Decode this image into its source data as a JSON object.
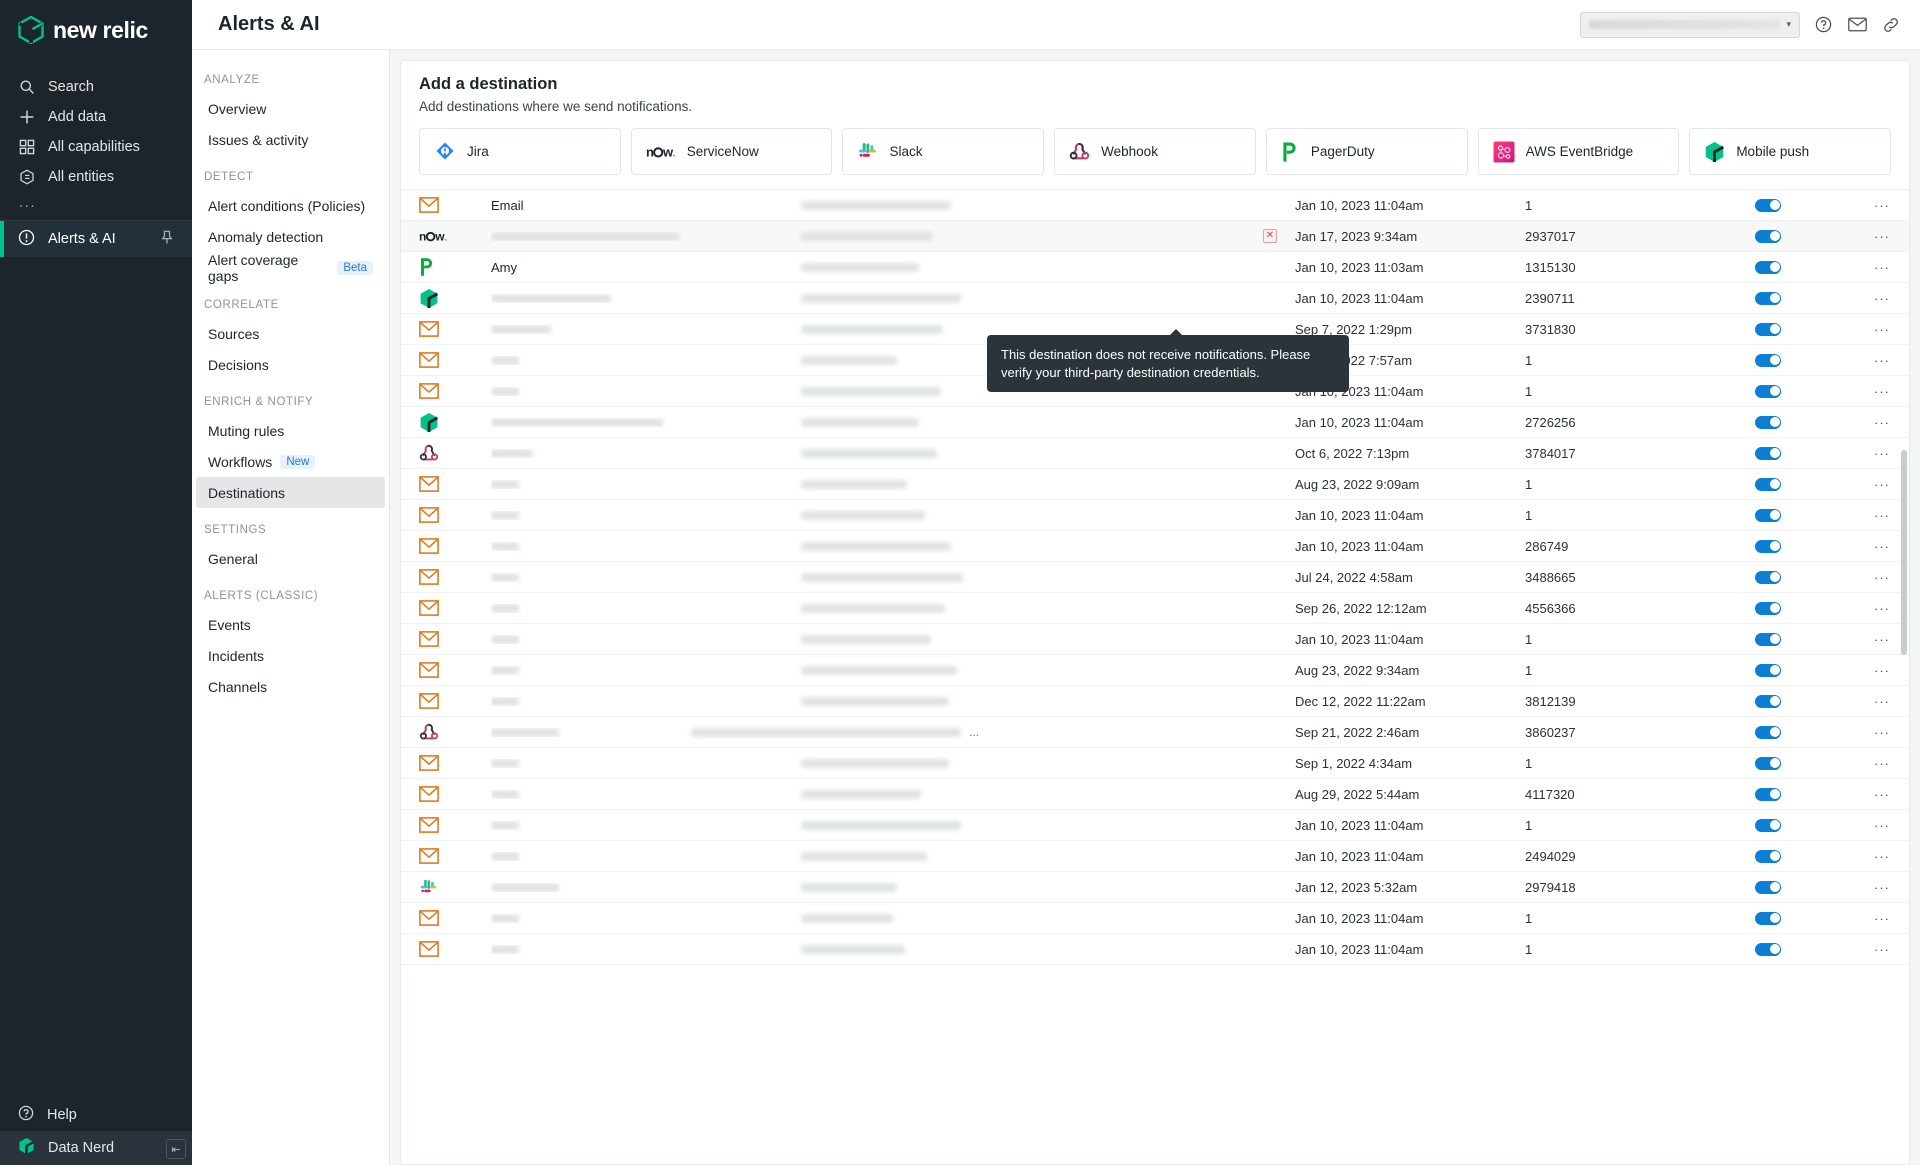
{
  "brand": {
    "name": "new relic",
    "dot": "."
  },
  "primary_nav": {
    "items": [
      {
        "label": "Search",
        "icon": "search-icon"
      },
      {
        "label": "Add data",
        "icon": "plus-icon"
      },
      {
        "label": "All capabilities",
        "icon": "grid-icon"
      },
      {
        "label": "All entities",
        "icon": "hexagon-list-icon"
      }
    ],
    "more": "...",
    "active_item": {
      "label": "Alerts & AI",
      "icon": "alert-circle-icon",
      "pin": "pin-icon"
    },
    "bottom": [
      {
        "label": "Help",
        "icon": "help-circle-icon"
      },
      {
        "label": "Data Nerd",
        "icon": "user-avatar-icon"
      }
    ],
    "collapse": "⇤"
  },
  "header": {
    "title": "Alerts & AI",
    "account_selector_placeholder": "",
    "icons": [
      "help-icon",
      "mail-icon",
      "link-icon"
    ]
  },
  "secondary_nav": {
    "groups": [
      {
        "label": "ANALYZE",
        "items": [
          {
            "label": "Overview"
          },
          {
            "label": "Issues & activity"
          }
        ]
      },
      {
        "label": "DETECT",
        "items": [
          {
            "label": "Alert conditions (Policies)"
          },
          {
            "label": "Anomaly detection"
          },
          {
            "label": "Alert coverage gaps",
            "badge": "Beta"
          }
        ]
      },
      {
        "label": "CORRELATE",
        "items": [
          {
            "label": "Sources"
          },
          {
            "label": "Decisions"
          }
        ]
      },
      {
        "label": "ENRICH & NOTIFY",
        "items": [
          {
            "label": "Muting rules"
          },
          {
            "label": "Workflows",
            "badge": "New"
          },
          {
            "label": "Destinations",
            "active": true
          }
        ]
      },
      {
        "label": "SETTINGS",
        "items": [
          {
            "label": "General"
          }
        ]
      },
      {
        "label": "ALERTS (CLASSIC)",
        "items": [
          {
            "label": "Events"
          },
          {
            "label": "Incidents"
          },
          {
            "label": "Channels"
          }
        ]
      }
    ]
  },
  "main": {
    "title": "Add a destination",
    "subtitle": "Add destinations where we send notifications.",
    "destination_cards": [
      {
        "label": "Jira",
        "icon": "jira-icon"
      },
      {
        "label": "ServiceNow",
        "icon": "servicenow-icon"
      },
      {
        "label": "Slack",
        "icon": "slack-icon"
      },
      {
        "label": "Webhook",
        "icon": "webhook-icon"
      },
      {
        "label": "PagerDuty",
        "icon": "pagerduty-icon"
      },
      {
        "label": "AWS EventBridge",
        "icon": "aws-eventbridge-icon"
      },
      {
        "label": "Mobile push",
        "icon": "mobile-push-icon"
      }
    ],
    "table": {
      "rows": [
        {
          "icon": "email-icon",
          "name": "Email",
          "date": "Jan 10, 2023 11:04am",
          "count": "1",
          "enabled": true
        },
        {
          "icon": "servicenow-icon",
          "name": "",
          "date": "Jan 17, 2023 9:34am",
          "count": "2937017",
          "enabled": true,
          "error": true
        },
        {
          "icon": "pagerduty-icon",
          "name": "Amy",
          "date": "Jan 10, 2023 11:03am",
          "count": "1315130",
          "enabled": true
        },
        {
          "icon": "mobile-push-icon",
          "name": "",
          "date": "Jan 10, 2023 11:04am",
          "count": "2390711",
          "enabled": true
        },
        {
          "icon": "email-icon",
          "name": "",
          "date": "Sep 7, 2022 1:29pm",
          "count": "3731830",
          "enabled": true
        },
        {
          "icon": "email-icon",
          "name": "",
          "date": "Sep 1, 2022 7:57am",
          "count": "1",
          "enabled": true
        },
        {
          "icon": "email-icon",
          "name": "",
          "date": "Jan 10, 2023 11:04am",
          "count": "1",
          "enabled": true
        },
        {
          "icon": "mobile-push-icon",
          "name": "",
          "date": "Jan 10, 2023 11:04am",
          "count": "2726256",
          "enabled": true
        },
        {
          "icon": "webhook-icon",
          "name": "",
          "date": "Oct 6, 2022 7:13pm",
          "count": "3784017",
          "enabled": true
        },
        {
          "icon": "email-icon",
          "name": "",
          "date": "Aug 23, 2022 9:09am",
          "count": "1",
          "enabled": true
        },
        {
          "icon": "email-icon",
          "name": "",
          "date": "Jan 10, 2023 11:04am",
          "count": "1",
          "enabled": true
        },
        {
          "icon": "email-icon",
          "name": "",
          "date": "Jan 10, 2023 11:04am",
          "count": "286749",
          "enabled": true
        },
        {
          "icon": "email-icon",
          "name": "",
          "date": "Jul 24, 2022 4:58am",
          "count": "3488665",
          "enabled": true
        },
        {
          "icon": "email-icon",
          "name": "",
          "date": "Sep 26, 2022 12:12am",
          "count": "4556366",
          "enabled": true
        },
        {
          "icon": "email-icon",
          "name": "",
          "date": "Jan 10, 2023 11:04am",
          "count": "1",
          "enabled": true
        },
        {
          "icon": "email-icon",
          "name": "",
          "date": "Aug 23, 2022 9:34am",
          "count": "1",
          "enabled": true
        },
        {
          "icon": "email-icon",
          "name": "",
          "date": "Dec 12, 2022 11:22am",
          "count": "3812139",
          "enabled": true
        },
        {
          "icon": "webhook-icon",
          "name": "",
          "date": "Sep 21, 2022 2:46am",
          "count": "3860237",
          "enabled": true,
          "overflow": "..."
        },
        {
          "icon": "email-icon",
          "name": "",
          "date": "Sep 1, 2022 4:34am",
          "count": "1",
          "enabled": true
        },
        {
          "icon": "email-icon",
          "name": "",
          "date": "Aug 29, 2022 5:44am",
          "count": "4117320",
          "enabled": true
        },
        {
          "icon": "email-icon",
          "name": "",
          "date": "Jan 10, 2023 11:04am",
          "count": "1",
          "enabled": true
        },
        {
          "icon": "email-icon",
          "name": "",
          "date": "Jan 10, 2023 11:04am",
          "count": "2494029",
          "enabled": true
        },
        {
          "icon": "slack-icon",
          "name": "",
          "date": "Jan 12, 2023 5:32am",
          "count": "2979418",
          "enabled": true
        },
        {
          "icon": "email-icon",
          "name": "",
          "date": "Jan 10, 2023 11:04am",
          "count": "1",
          "enabled": true
        },
        {
          "icon": "email-icon",
          "name": "",
          "date": "Jan 10, 2023 11:04am",
          "count": "1",
          "enabled": true
        }
      ],
      "row_menu": "···"
    }
  },
  "tooltip": {
    "text": "This destination does not receive notifications. Please verify your third-party destination credentials."
  },
  "colors": {
    "nav_bg": "#1d252c",
    "accent_green": "#00c389",
    "toggle_on": "#0b7fd4",
    "badge_blue": "#1d7dd4",
    "email_orange": "#e07b20",
    "tooltip_bg": "#2b343b"
  }
}
